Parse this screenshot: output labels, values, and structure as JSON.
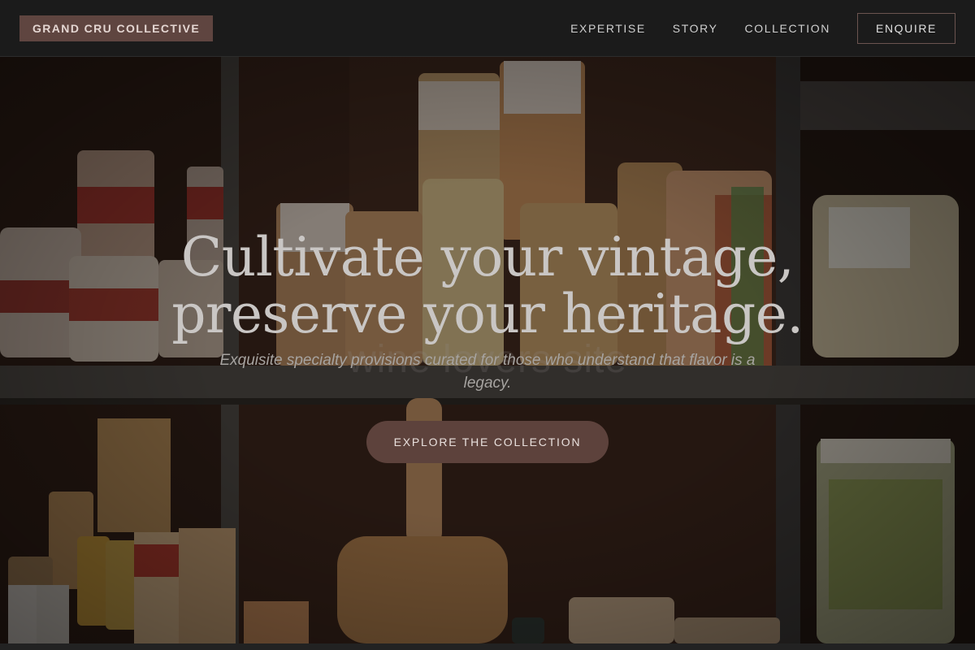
{
  "header": {
    "brand": "GRAND CRU COLLECTIVE",
    "nav": [
      "EXPERTISE",
      "STORY",
      "COLLECTION"
    ],
    "enquire_label": "ENQUIRE"
  },
  "hero": {
    "title_line1": "Cultivate your vintage,",
    "title_line2": "preserve your heritage.",
    "watermark": "wine lovers site",
    "subtitle": "Exquisite specialty provisions curated for those who understand that flavor is a legacy.",
    "cta_label": "EXPLORE THE COLLECTION"
  },
  "colors": {
    "header_bg": "#1b1b1b",
    "brand_bg": "#5f4540",
    "cta_bg": "#5d423c",
    "enquire_border": "#6b5450"
  }
}
